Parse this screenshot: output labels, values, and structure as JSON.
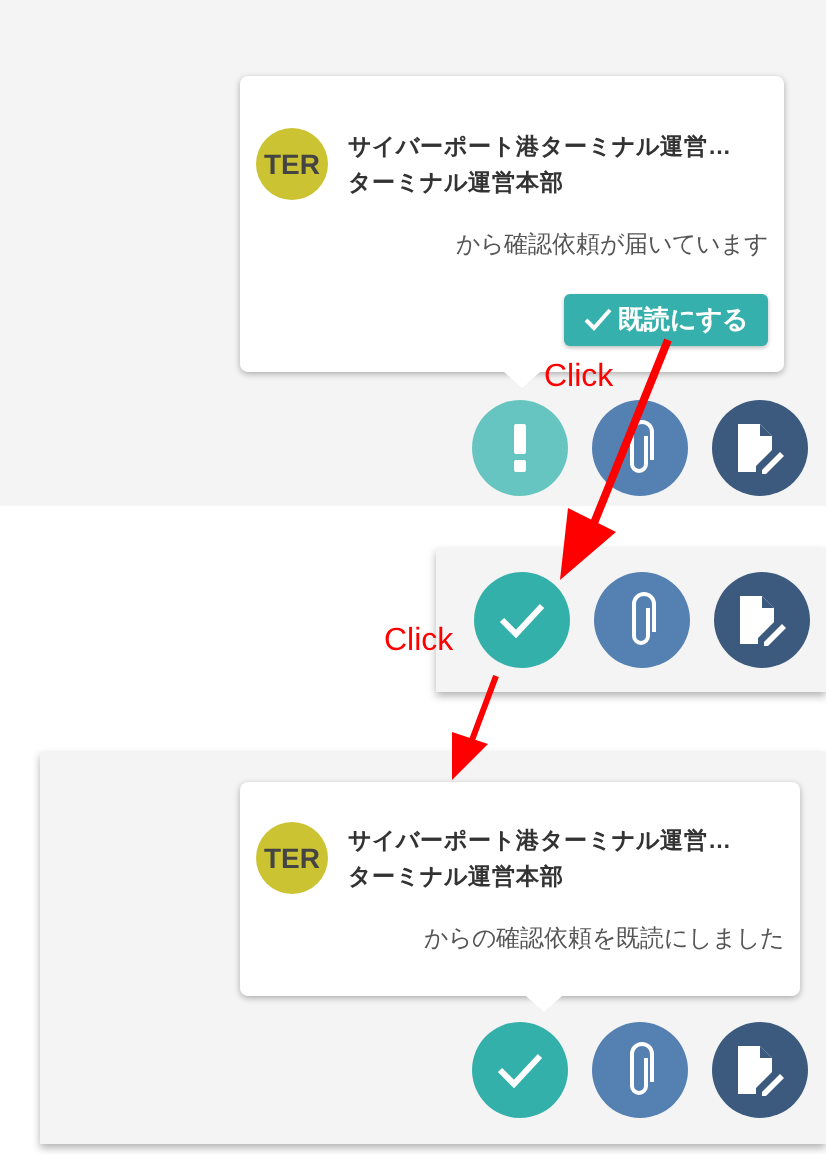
{
  "panels": [
    {
      "kind": "popup",
      "card": {
        "avatar": "TER",
        "color": "#cbc332",
        "sender": "サイバーポート港ターミナル運営…",
        "department": "ターミナル運営本部",
        "message": "から確認依頼が届いています",
        "button": "既読にする"
      },
      "actions": [
        {
          "kind": "alert"
        },
        {
          "kind": "attach"
        },
        {
          "kind": "edit"
        }
      ]
    },
    {
      "kind": "bar",
      "actions": [
        {
          "kind": "check"
        },
        {
          "kind": "attach"
        },
        {
          "kind": "edit"
        }
      ]
    },
    {
      "kind": "popup",
      "card": {
        "avatar": "TER",
        "color": "#cbc332",
        "sender": "サイバーポート港ターミナル運営…",
        "department": "ターミナル運営本部",
        "message": "からの確認依頼を既読にしました"
      },
      "actions": [
        {
          "kind": "check"
        },
        {
          "kind": "attach"
        },
        {
          "kind": "edit"
        }
      ]
    }
  ],
  "annotations": [
    {
      "label": "Click"
    },
    {
      "label": "Click"
    }
  ]
}
